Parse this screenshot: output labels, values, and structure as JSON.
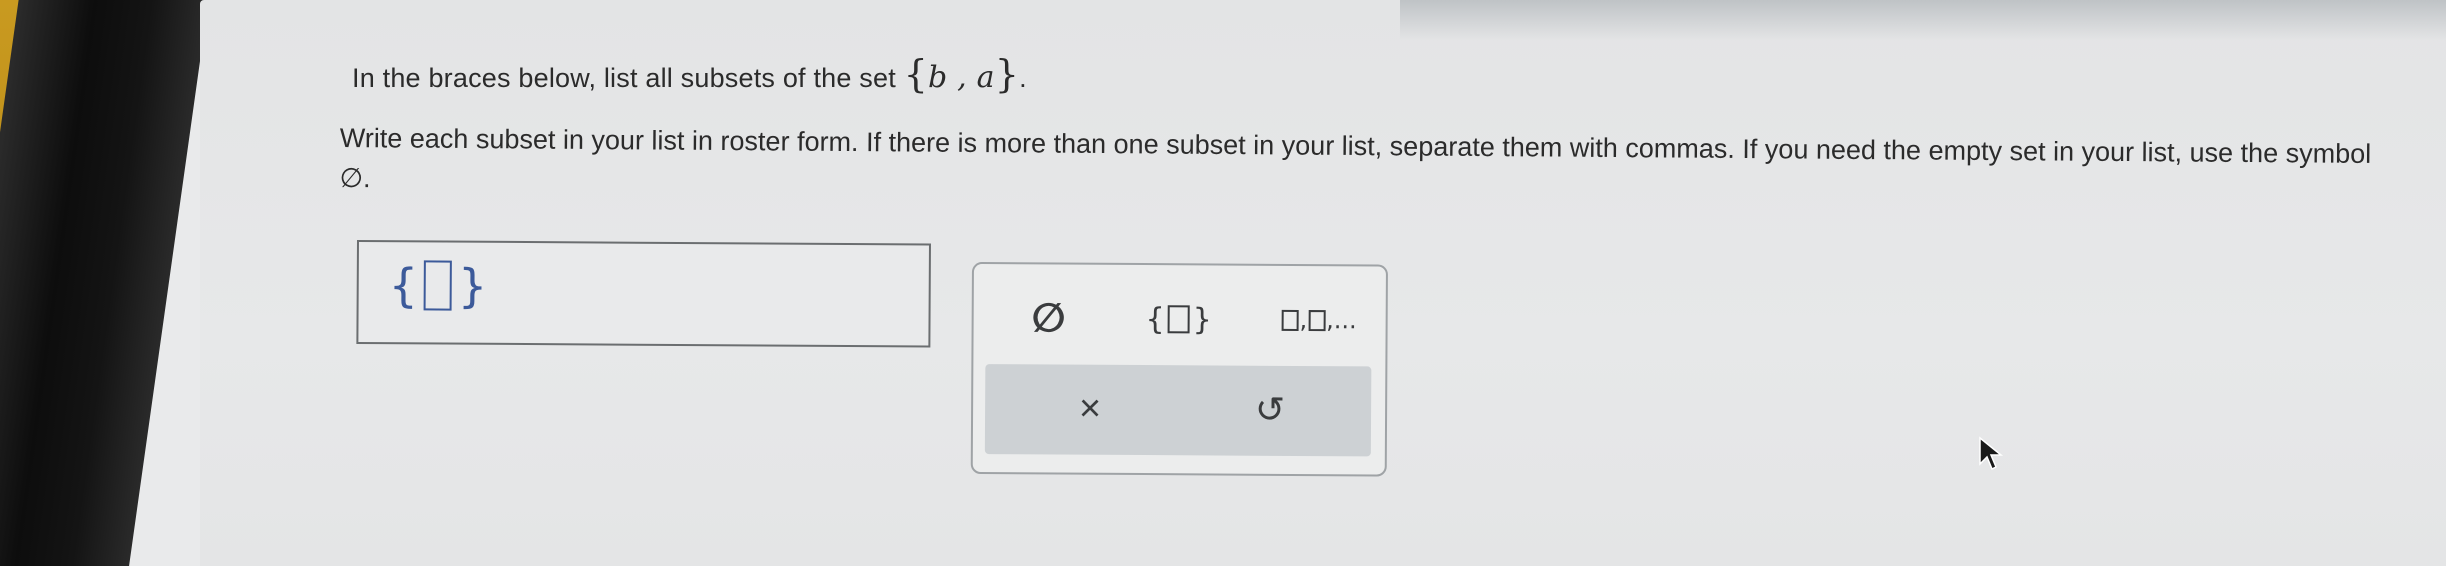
{
  "question": {
    "line1_prefix": "In the braces below, list all subsets of the set ",
    "set_open": "{",
    "set_elements": "b , a",
    "set_close": "}",
    "line1_suffix": ".",
    "instructions": "Write each subset in your list in roster form. If there is more than one subset in your list, separate them with commas. If you need the empty set in your list, use the symbol ∅."
  },
  "answer": {
    "open_brace": "{",
    "close_brace": "}"
  },
  "palette": {
    "empty_set_symbol": "∅",
    "braces_open": "{",
    "braces_close": "}",
    "list_separator": ",",
    "list_ellipsis": ",...",
    "clear_symbol": "×",
    "undo_symbol": "↺"
  },
  "icons": {
    "clear": "close-icon",
    "undo": "undo-icon",
    "pointer": "mouse-pointer-icon"
  }
}
